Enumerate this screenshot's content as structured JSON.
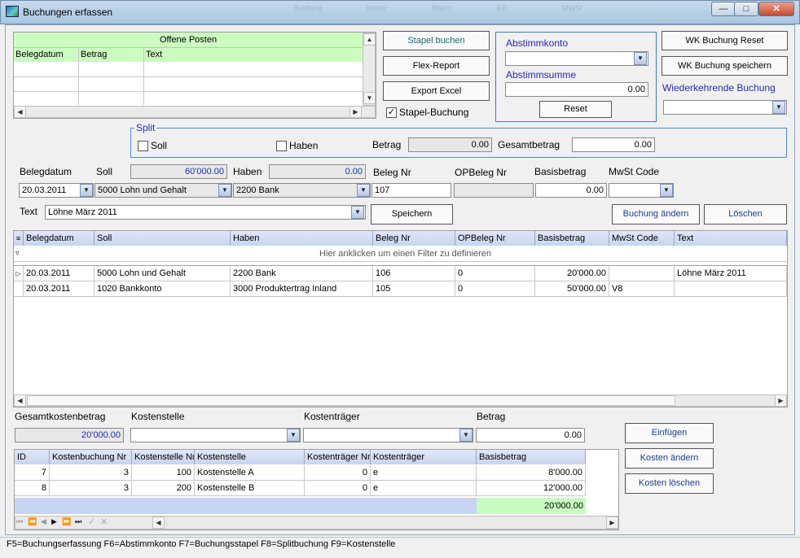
{
  "window": {
    "title": "Buchungen erfassen",
    "toolbar_ghost": [
      "Buchung",
      "Konto",
      "Bilanz",
      "ER",
      "MWSt"
    ]
  },
  "op": {
    "title": "Offene Posten",
    "columns": [
      "Belegdatum",
      "Betrag",
      "Text"
    ]
  },
  "buttons": {
    "stapel_buchen": "Stapel buchen",
    "flex_report": "Flex-Report",
    "export_excel": "Export Excel",
    "reset": "Reset",
    "wk_reset": "WK Buchung Reset",
    "wk_save": "WK Buchung speichern",
    "speichern": "Speichern",
    "buchung_aendern": "Buchung ändern",
    "loeschen": "Löschen",
    "einfuegen": "Einfügen",
    "kosten_aendern": "Kosten ändern",
    "kosten_loeschen": "Kosten löschen"
  },
  "stapel": {
    "label": "Stapel-Buchung",
    "checked": true
  },
  "abstimm": {
    "konto_label": "Abstimmkonto",
    "summe_label": "Abstimmsumme",
    "summe_value": "0.00"
  },
  "wk": {
    "label": "Wiederkehrende Buchung"
  },
  "split": {
    "legend": "Split",
    "soll": "Soll",
    "haben": "Haben",
    "betrag_label": "Betrag",
    "betrag_value": "0.00",
    "gesamt_label": "Gesamtbetrag",
    "gesamt_value": "0.00"
  },
  "form": {
    "belegdatum_label": "Belegdatum",
    "soll_label": "Soll",
    "soll_sum": "60'000.00",
    "haben_label": "Haben",
    "haben_sum": "0.00",
    "belegnr_label": "Beleg Nr",
    "opbeleg_label": "OPBeleg Nr",
    "basis_label": "Basisbetrag",
    "mwst_label": "MwSt Code",
    "belegdatum": "20.03.2011",
    "soll": "5000 Lohn und Gehalt",
    "haben": "2200 Bank",
    "belegnr": "107",
    "opbeleg": "",
    "basis": "0.00",
    "mwst": "",
    "text_label": "Text",
    "text": "Löhne März 2011"
  },
  "main_grid": {
    "columns": [
      "Belegdatum",
      "Soll",
      "Haben",
      "Beleg Nr",
      "OPBeleg Nr",
      "Basisbetrag",
      "MwSt Code",
      "Text"
    ],
    "filter_hint": "Hier anklicken um einen Filter zu definieren",
    "rows": [
      [
        "20.03.2011",
        "5000 Lohn und Gehalt",
        "2200 Bank",
        "106",
        "0",
        "20'000.00",
        "",
        "Löhne März 2011"
      ],
      [
        "20.03.2011",
        "1020 Bankkonto",
        "3000 Produktertrag Inland",
        "105",
        "0",
        "50'000.00",
        "V8",
        ""
      ]
    ]
  },
  "kosten": {
    "gesamt_label": "Gesamtkostenbetrag",
    "gesamt_value": "20'000.00",
    "stelle_label": "Kostenstelle",
    "traeger_label": "Kostenträger",
    "betrag_label": "Betrag",
    "betrag_value": "0.00"
  },
  "kosten_grid": {
    "columns": [
      "ID",
      "Kostenbuchung Nr",
      "Kostenstelle Nr",
      "Kostenstelle",
      "Kostenträger Nr",
      "Kostenträger",
      "Basisbetrag"
    ],
    "rows": [
      [
        "7",
        "3",
        "100",
        "Kostenstelle A",
        "0",
        "e",
        "8'000.00"
      ],
      [
        "8",
        "3",
        "200",
        "Kostenstelle B",
        "0",
        "e",
        "12'000.00"
      ]
    ],
    "total": "20'000.00"
  },
  "status": "F5=Buchungserfassung F6=Abstimmkonto F7=Buchungsstapel F8=Splitbuchung F9=Kostenstelle"
}
